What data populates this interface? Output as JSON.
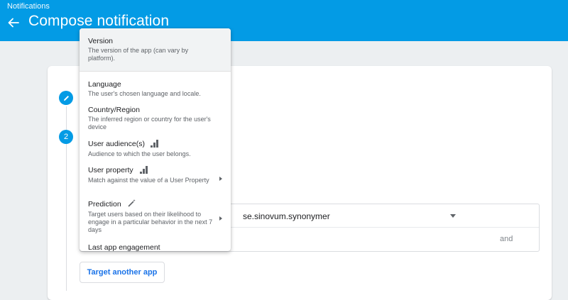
{
  "appbar": {
    "breadcrumb": "Notifications",
    "title": "Compose notification"
  },
  "steps": [
    {
      "number": ""
    },
    {
      "number": "2"
    }
  ],
  "target": {
    "app_value": "se.sinovum.synonymer",
    "and_label": "and",
    "target_another_app": "Target another app"
  },
  "menu": {
    "items": [
      {
        "title": "Version",
        "description": "The version of the app (can vary by platform)."
      },
      {
        "title": "Language",
        "description": "The user's chosen language and locale."
      },
      {
        "title": "Country/Region",
        "description": "The inferred region or country for the user's device"
      },
      {
        "title": "User audience(s)",
        "description": "Audience to which the user belongs."
      },
      {
        "title": "User property",
        "description": "Match against the value of a User Property"
      },
      {
        "title": "Prediction",
        "description": "Target users based on their likelihood to engage in a particular behavior in the next 7 days"
      },
      {
        "title": "Last app engagement",
        "description": ""
      }
    ]
  },
  "colors": {
    "appbar": "#039be5",
    "accent_text": "#1a73e8",
    "menu_highlight": "#f1f3f4"
  },
  "icons": [
    "back-arrow-icon",
    "pencil-icon",
    "bar-chart-icon",
    "magic-wand-icon",
    "chevron-right-icon",
    "dropdown-arrow-icon"
  ]
}
